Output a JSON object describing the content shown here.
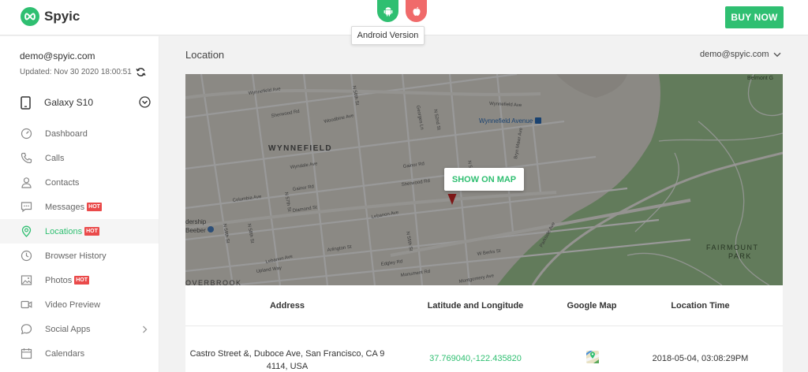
{
  "header": {
    "brand": "Spyic",
    "tooltip": "Android Version",
    "buy_now": "BUY NOW"
  },
  "sidebar": {
    "email": "demo@spyic.com",
    "updated": "Updated: Nov 30 2020 18:00:51",
    "device": "Galaxy S10",
    "items": [
      {
        "label": "Dashboard",
        "hot": "",
        "icon": "dashboard-gauge-icon"
      },
      {
        "label": "Calls",
        "hot": "",
        "icon": "phone-icon"
      },
      {
        "label": "Contacts",
        "hot": "",
        "icon": "person-icon"
      },
      {
        "label": "Messages",
        "hot": "HOT",
        "icon": "message-icon"
      },
      {
        "label": "Locations",
        "hot": "HOT",
        "icon": "location-pin-icon"
      },
      {
        "label": "Browser History",
        "hot": "",
        "icon": "clock-icon"
      },
      {
        "label": "Photos",
        "hot": "HOT",
        "icon": "image-icon"
      },
      {
        "label": "Video Preview",
        "hot": "",
        "icon": "video-camera-icon"
      },
      {
        "label": "Social Apps",
        "hot": "",
        "icon": "chat-bubble-icon"
      },
      {
        "label": "Calendars",
        "hot": "",
        "icon": "calendar-icon"
      }
    ],
    "active_item": "Locations"
  },
  "main": {
    "title": "Location",
    "user_menu": "demo@spyic.com",
    "show_on_map": "SHOW ON MAP",
    "map_labels": {
      "wynnefield": "WYNNEFIELD",
      "fairmount": "FAIRMOUNT",
      "park": "PARK",
      "overbrook": "OVERBROOK",
      "station": "Wynnefield Avenue",
      "belmont": "Belmont G",
      "leadership": "dership",
      "beeber": "Beeber",
      "streets": {
        "wynnefield_ave_1": "Wynnefield Ave",
        "wynnefield_ave_2": "Wynnefield Ave",
        "woodbine": "Woodbine Ave",
        "sherwood": "Sherwood Rd",
        "lebanon_1": "Lebanon Ave",
        "lebanon_2": "Lebanon Ave",
        "upland": "Upland Way",
        "parkside": "Parkside Ave",
        "brynmawr": "Bryn Mawr Ave",
        "n54": "N 54th St",
        "n55": "N 55th St",
        "n57": "N 57th St",
        "n59": "N 59th St",
        "n58": "N 58th St",
        "n52": "N 52nd St",
        "n56": "N 56th St",
        "georges": "Georges Ln",
        "wyndale": "Wyndale Ave",
        "gainor": "Gainor Rd",
        "diamond": "Diamond St",
        "berks": "W Berks St",
        "montgomery": "Montgomery Ave",
        "columbia": "Columbia Ave",
        "sherwood2": "Sherwood Rd",
        "arlington": "Arlington St",
        "gainor2": "Gainor Rd",
        "monument": "Monument Rd",
        "edgley": "Edgley Rd"
      }
    },
    "table": {
      "headers": [
        "Address",
        "Latitude and Longitude",
        "Google Map",
        "Location Time"
      ],
      "rows": [
        {
          "address_line1": "Castro Street &, Duboce Ave, San Francisco, CA 9",
          "address_line2": "4114, USA",
          "coords": "37.769040,-122.435820",
          "time": "2018-05-04,  03:08:29PM"
        }
      ]
    }
  },
  "colors": {
    "brand_green": "#2fbf71",
    "hot_red": "#ea4a4a",
    "apple_red": "#f06a6a",
    "park_green": "#5e7b55"
  }
}
